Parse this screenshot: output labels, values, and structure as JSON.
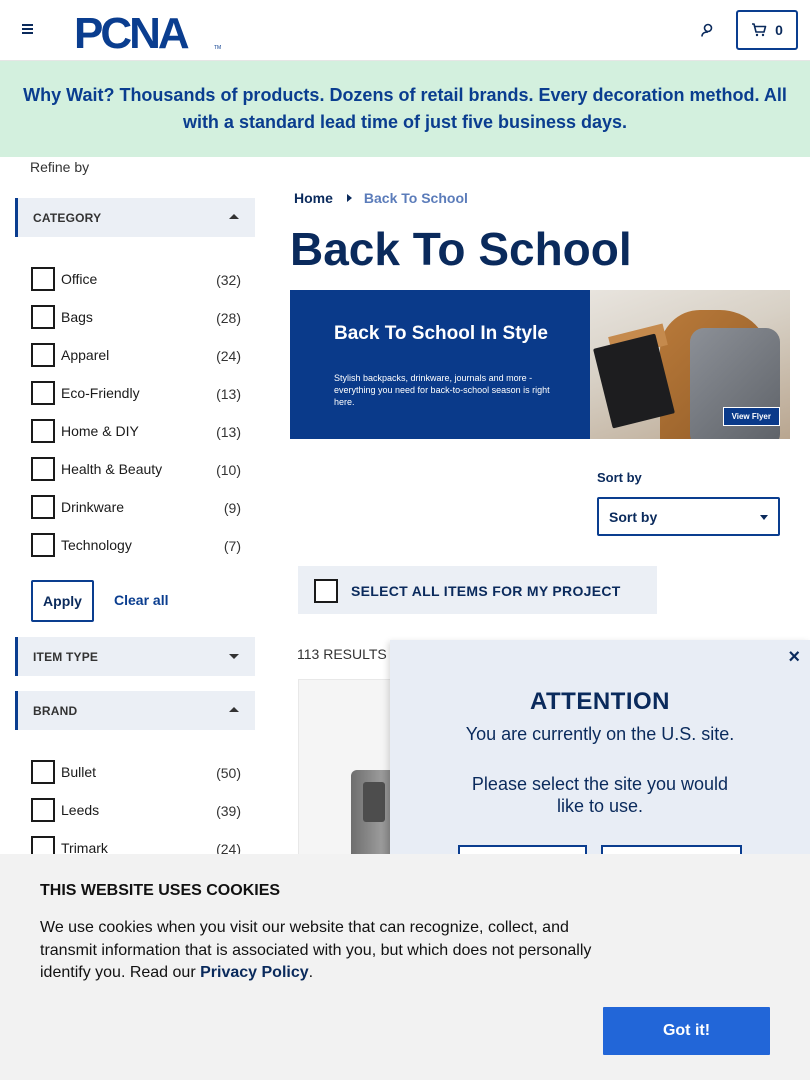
{
  "header": {
    "logo_text": "PCNA",
    "logo_tm": "TM",
    "cart_count": "0",
    "colors": {
      "brand_blue": "#0a3d8f",
      "navy": "#0a2a5c"
    }
  },
  "promo": {
    "text": "Why Wait? Thousands of products. Dozens of retail brands. Every decoration method. All with a standard lead time of just five business days.",
    "background": "#d3f0de"
  },
  "sidebar": {
    "refine_label": "Refine by",
    "category": {
      "title": "CATEGORY",
      "items": [
        {
          "label": "Office",
          "count": "(32)"
        },
        {
          "label": "Bags",
          "count": "(28)"
        },
        {
          "label": "Apparel",
          "count": "(24)"
        },
        {
          "label": "Eco-Friendly",
          "count": "(13)"
        },
        {
          "label": "Home & DIY",
          "count": "(13)"
        },
        {
          "label": "Health & Beauty",
          "count": "(10)"
        },
        {
          "label": "Drinkware",
          "count": "(9)"
        },
        {
          "label": "Technology",
          "count": "(7)"
        }
      ]
    },
    "apply_label": "Apply",
    "clear_label": "Clear all",
    "item_type": {
      "title": "ITEM TYPE"
    },
    "brand": {
      "title": "BRAND",
      "items": [
        {
          "label": "Bullet",
          "count": "(50)"
        },
        {
          "label": "Leeds",
          "count": "(39)"
        },
        {
          "label": "Trimark",
          "count": "(24)"
        }
      ]
    }
  },
  "main": {
    "breadcrumb": {
      "home": "Home",
      "current": "Back To School"
    },
    "title": "Back To School",
    "hero": {
      "title": "Back To School In Style",
      "subtitle": "Stylish backpacks, drinkware, journals and more - everything you need for back-to-school season is right here.",
      "cta": "View Flyer"
    },
    "sort": {
      "label": "Sort by",
      "selected": "Sort by"
    },
    "select_all_label": "SELECT ALL ITEMS FOR MY PROJECT",
    "results_label": "113 RESULTS"
  },
  "site_modal": {
    "close": "×",
    "title": "ATTENTION",
    "line1": "You are currently on the U.S. site.",
    "line2": "Please select the site you would like to use."
  },
  "cookie": {
    "title": "THIS WEBSITE USES COOKIES",
    "text": "We use cookies when you visit our website that can recognize, collect, and transmit information that is associated with you, but which does not personally identify you. Read our",
    "link": "Privacy Policy",
    "period": ".",
    "button": "Got it!",
    "button_color": "#2266d8"
  }
}
